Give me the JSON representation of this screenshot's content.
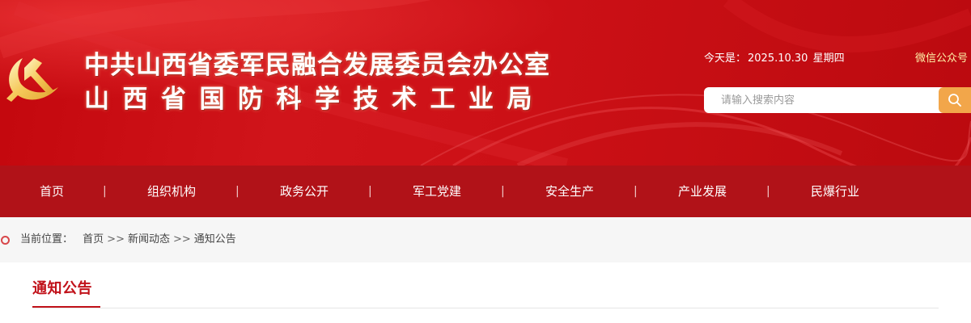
{
  "header": {
    "title_line1": "中共山西省委军民融合发展委员会办公室",
    "title_line2": "山西省国防科学技术工业局",
    "date_label": "今天是：",
    "date": "2025.10.30",
    "weekday": "星期四",
    "wechat_label": "微信公众号",
    "search_placeholder": "请输入搜索内容",
    "emblem_icon": "party-emblem-icon",
    "search_icon": "search-icon"
  },
  "nav": {
    "items": [
      {
        "label": "首页"
      },
      {
        "label": "组织机构"
      },
      {
        "label": "政务公开"
      },
      {
        "label": "军工党建"
      },
      {
        "label": "安全生产"
      },
      {
        "label": "产业发展"
      },
      {
        "label": "民爆行业"
      }
    ],
    "separator": "|"
  },
  "breadcrumb": {
    "label": "当前位置：",
    "items": [
      "首页",
      "新闻动态",
      "通知公告"
    ],
    "separator": ">>"
  },
  "section": {
    "title": "通知公告"
  },
  "colors": {
    "banner_red": "#cc1016",
    "nav_red": "#b11218",
    "accent_red": "#c1121a",
    "search_button": "#f2a64a",
    "wechat_text": "#fff3a8"
  }
}
